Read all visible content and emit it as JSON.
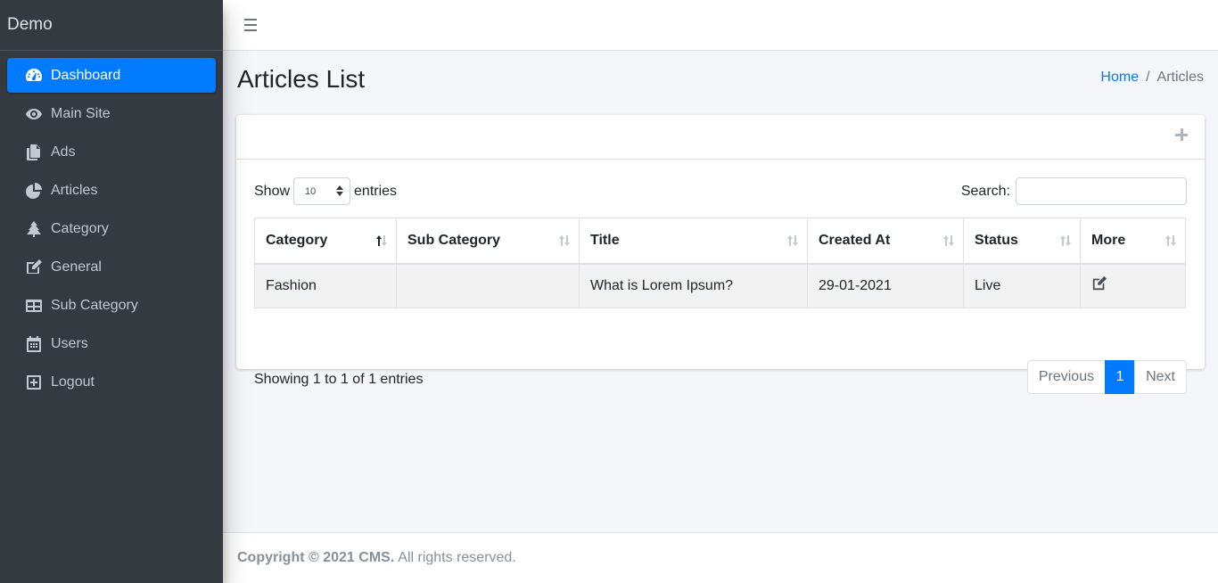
{
  "brand": "Demo",
  "sidebar": {
    "items": [
      {
        "label": "Dashboard",
        "icon": "dashboard-icon",
        "active": true
      },
      {
        "label": "Main Site",
        "icon": "eye-icon"
      },
      {
        "label": "Ads",
        "icon": "copy-icon"
      },
      {
        "label": "Articles",
        "icon": "chart-pie-icon"
      },
      {
        "label": "Category",
        "icon": "tree-icon"
      },
      {
        "label": "General",
        "icon": "edit-icon"
      },
      {
        "label": "Sub Category",
        "icon": "table-icon"
      },
      {
        "label": "Users",
        "icon": "calendar-icon"
      },
      {
        "label": "Logout",
        "icon": "plus-square-icon"
      }
    ]
  },
  "header": {
    "title": "Articles List",
    "breadcrumb": {
      "home": "Home",
      "separator": "/",
      "current": "Articles"
    }
  },
  "table_controls": {
    "show_label": "Show",
    "entries_label": "entries",
    "page_size": "10",
    "search_label": "Search:",
    "search_value": ""
  },
  "table": {
    "columns": [
      "Category",
      "Sub Category",
      "Title",
      "Created At",
      "Status",
      "More"
    ],
    "rows": [
      {
        "category": "Fashion",
        "sub_category": "",
        "title": "What is Lorem Ipsum?",
        "created_at": "29-01-2021",
        "status": "Live",
        "more_icon": "edit-icon"
      }
    ]
  },
  "pagination": {
    "info": "Showing 1 to 1 of 1 entries",
    "previous": "Previous",
    "current_page": "1",
    "next": "Next"
  },
  "footer": {
    "copyright": "Copyright © 2021 CMS.",
    "rights": "All rights reserved."
  },
  "colors": {
    "sidebar_bg": "#343a40",
    "accent": "#007bff",
    "content_bg": "#f4f6f9"
  }
}
